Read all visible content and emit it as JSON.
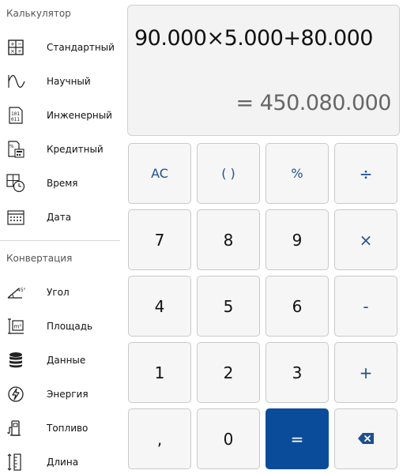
{
  "sidebar": {
    "calc_title": "Калькулятор",
    "calc_items": [
      {
        "label": "Стандартный",
        "icon": "standard-calculator-icon"
      },
      {
        "label": "Научный",
        "icon": "scientific-wave-icon"
      },
      {
        "label": "Инженерный",
        "icon": "binary-code-icon"
      },
      {
        "label": "Кредитный",
        "icon": "loan-document-icon"
      },
      {
        "label": "Время",
        "icon": "time-calculator-icon"
      },
      {
        "label": "Дата",
        "icon": "calendar-icon"
      }
    ],
    "conv_title": "Конвертация",
    "conv_items": [
      {
        "label": "Угол",
        "icon": "angle-icon"
      },
      {
        "label": "Площадь",
        "icon": "area-icon"
      },
      {
        "label": "Данные",
        "icon": "database-icon"
      },
      {
        "label": "Энергия",
        "icon": "energy-icon"
      },
      {
        "label": "Топливо",
        "icon": "fuel-pump-icon"
      },
      {
        "label": "Длина",
        "icon": "ruler-icon"
      }
    ]
  },
  "display": {
    "expression": "90.000×5.000+80.000",
    "result": "= 450.080.000"
  },
  "keypad": {
    "rows": [
      [
        "AC",
        "( )",
        "%",
        "÷"
      ],
      [
        "7",
        "8",
        "9",
        "×"
      ],
      [
        "4",
        "5",
        "6",
        "-"
      ],
      [
        "1",
        "2",
        "3",
        "+"
      ],
      [
        ",",
        "0",
        "=",
        "backspace"
      ]
    ]
  },
  "colors": {
    "accent": "#0b4c9a",
    "operator_text": "#1e4f8f",
    "key_bg": "#f6f6f6",
    "display_bg": "#f3f3f3"
  }
}
